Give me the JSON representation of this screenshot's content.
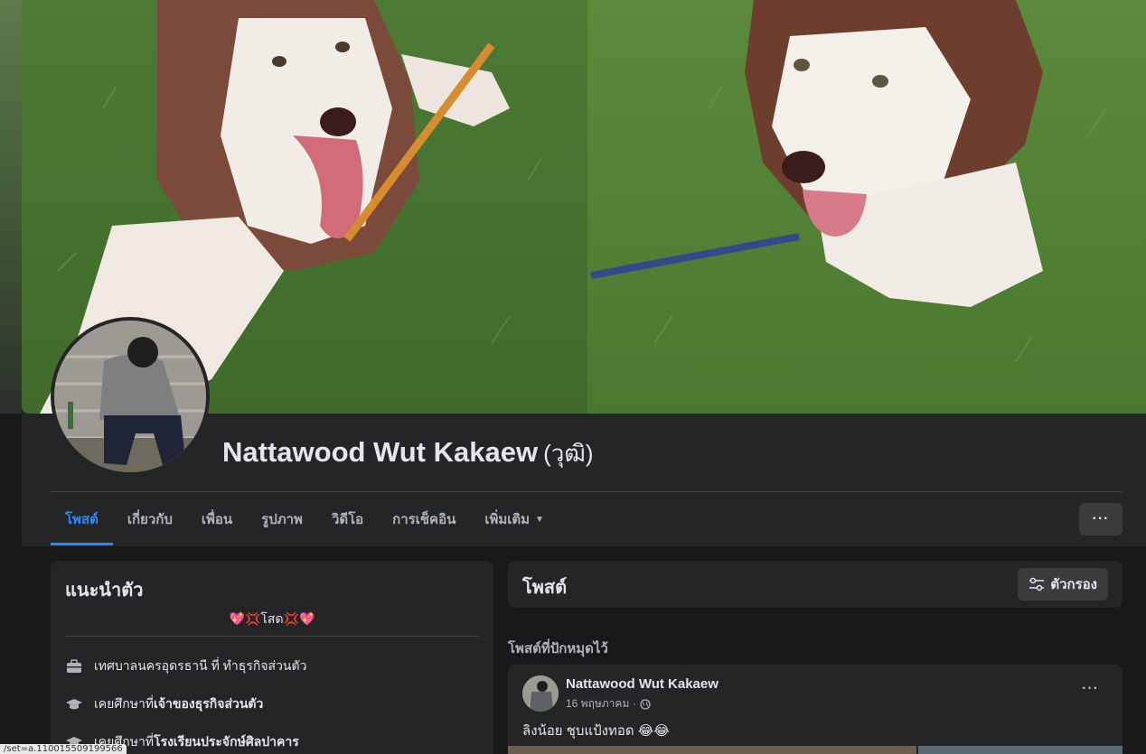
{
  "profile": {
    "name": "Nattawood Wut Kakaew",
    "alt_name": "(วุฒิ)"
  },
  "tabs": [
    {
      "label": "โพสต์",
      "active": true
    },
    {
      "label": "เกี่ยวกับ",
      "active": false
    },
    {
      "label": "เพื่อน",
      "active": false
    },
    {
      "label": "รูปภาพ",
      "active": false
    },
    {
      "label": "วิดีโอ",
      "active": false
    },
    {
      "label": "การเช็คอิน",
      "active": false
    },
    {
      "label": "เพิ่มเติม",
      "active": false
    }
  ],
  "more_button_label": "···",
  "intro": {
    "title": "แนะนำตัว",
    "bio": "💖💢โสด💢💖",
    "items": [
      {
        "icon": "briefcase-icon",
        "prefix": "",
        "text": "เทศบาลนครอุดรธานี ที่ ทำธุรกิจส่วนตัว"
      },
      {
        "icon": "graduation-cap-icon",
        "prefix": "เคยศึกษาที่ ",
        "text": "เจ้าของธุรกิจส่วนตัว"
      },
      {
        "icon": "graduation-cap-icon",
        "prefix": "เคยศึกษาที่ ",
        "text": "โรงเรียนประจักษ์ศิลปาคาร"
      }
    ]
  },
  "posts": {
    "title": "โพสต์",
    "filter_label": "ตัวกรอง",
    "pinned_label": "โพสต์ที่ปักหมุดไว้",
    "pinned_post": {
      "author": "Nattawood Wut Kakaew",
      "date": "16 พฤษภาคม ·",
      "text": "ลิงน้อย ชุบแป้งทอด 😂😂",
      "more_label": "···"
    }
  },
  "status_bar": {
    "url": "/set=a.110015509199566"
  },
  "colors": {
    "accent": "#2d88ff",
    "background": "#18191a",
    "card": "#242526",
    "button": "#3a3b3c"
  }
}
